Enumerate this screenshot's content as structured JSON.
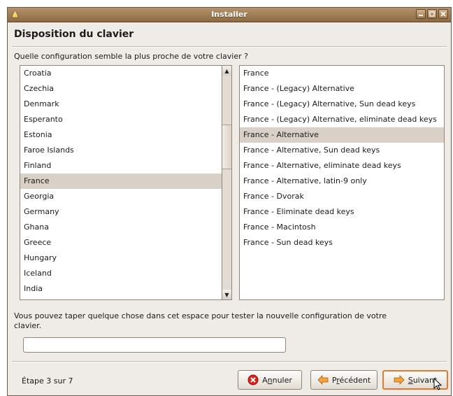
{
  "window": {
    "title": "Installer"
  },
  "page": {
    "heading": "Disposition du clavier",
    "question": "Quelle configuration semble la plus proche de votre clavier ?"
  },
  "countries": {
    "items": [
      "Croatia",
      "Czechia",
      "Denmark",
      "Esperanto",
      "Estonia",
      "Faroe Islands",
      "Finland",
      "France",
      "Georgia",
      "Germany",
      "Ghana",
      "Greece",
      "Hungary",
      "Iceland",
      "India"
    ],
    "selected": "France"
  },
  "variants": {
    "items": [
      "France",
      "France - (Legacy) Alternative",
      "France - (Legacy) Alternative, Sun dead keys",
      "France - (Legacy) Alternative, eliminate dead keys",
      "France - Alternative",
      "France - Alternative, Sun dead keys",
      "France - Alternative, eliminate dead keys",
      "France - Alternative, latin-9 only",
      "France - Dvorak",
      "France - Eliminate dead keys",
      "France - Macintosh",
      "France - Sun dead keys"
    ],
    "selected": "France - Alternative"
  },
  "test": {
    "label": "Vous pouvez taper quelque chose dans cet espace pour tester la nouvelle configuration de votre clavier.",
    "value": ""
  },
  "footer": {
    "step": "Étape 3 sur 7",
    "cancel": {
      "pre": "A",
      "mnemonic": "n",
      "post": "nuler"
    },
    "back": {
      "pre": "P",
      "mnemonic": "r",
      "post": "écédent"
    },
    "forward": {
      "pre": "",
      "mnemonic": "S",
      "post": "uivant"
    }
  },
  "colors": {
    "accent": "#e07a2e",
    "selection": "#d9d1c7",
    "titlebar": "#8c6a43"
  },
  "icons": {
    "window": "installer-icon",
    "cancel": "x-circle-icon",
    "back": "arrow-left-icon",
    "forward": "arrow-right-icon"
  }
}
